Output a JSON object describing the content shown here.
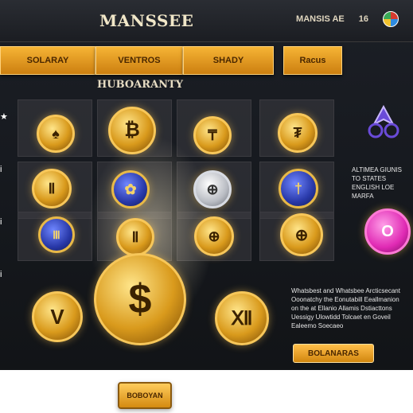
{
  "header": {
    "title": "MANSSEE",
    "right_label": "MANSIS AE",
    "right_number": "16",
    "globe_icon": "globe-icon"
  },
  "tabs": [
    {
      "label": "SOLARAY"
    },
    {
      "label": "VENTROS"
    },
    {
      "label": "SHADY"
    },
    {
      "label": "Racus"
    }
  ],
  "section": {
    "title": "HUBOARANTY"
  },
  "left_strip": [
    "★",
    "i",
    "i",
    "i",
    "i"
  ],
  "right_panel": {
    "text": "ALTIMEA GIUNIS TO STATES ENGLISH LOE MARFA",
    "logo_icon": "crest-icon"
  },
  "description": {
    "text": "Whatsbest and Whatsbee Arcticsecant Ooonatchy the Eonutabill Eeallmanion on the at Ellanio Allamis Dstiacttons Uessigy Ulowtidd Tolcaet en Goveil Ealeemo Soecaeo"
  },
  "cta": {
    "label": "BOLANARAS"
  },
  "bottom_button": {
    "label": "BOBOYAN"
  },
  "coins": [
    {
      "glyph": "♠",
      "style": "gold"
    },
    {
      "glyph": "₿",
      "style": "gold"
    },
    {
      "glyph": "₸",
      "style": "gold"
    },
    {
      "glyph": "₮",
      "style": "gold"
    },
    {
      "glyph": "Ⅱ",
      "style": "gold"
    },
    {
      "glyph": "✿",
      "style": "blue"
    },
    {
      "glyph": "⊕",
      "style": "silver"
    },
    {
      "glyph": "†",
      "style": "blue"
    },
    {
      "glyph": "Ⅲ",
      "style": "blue"
    },
    {
      "glyph": "Ⅱ",
      "style": "gold"
    },
    {
      "glyph": "⊕",
      "style": "gold"
    },
    {
      "glyph": "⊕",
      "style": "gold"
    },
    {
      "glyph": "O",
      "style": "pink"
    },
    {
      "glyph": "V",
      "style": "gold"
    },
    {
      "glyph": "$",
      "style": "gold"
    },
    {
      "glyph": "Ⅻ",
      "style": "gold"
    }
  ]
}
